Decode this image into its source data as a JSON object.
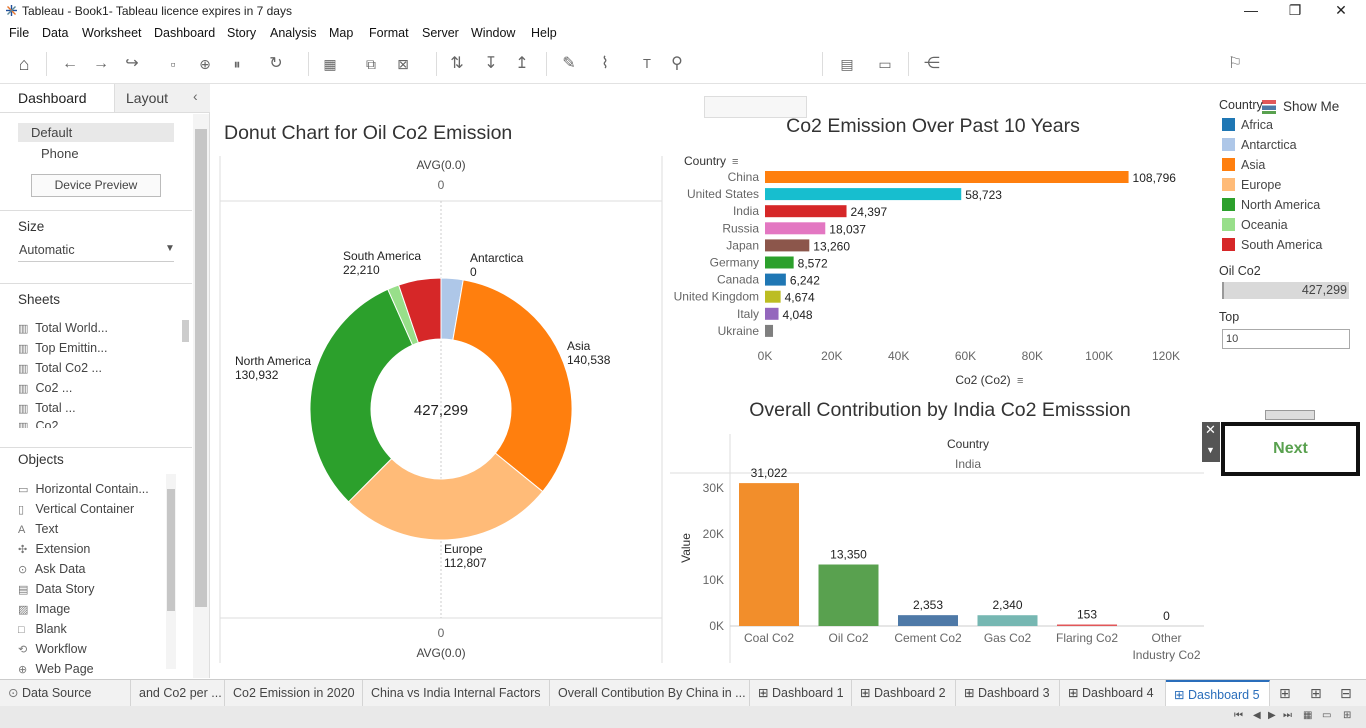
{
  "window": {
    "title": "Tableau - Book1- Tableau licence expires in 7 days",
    "minimize": "—",
    "restore": "❐",
    "close": "✕"
  },
  "menu": [
    "File",
    "Data",
    "Worksheet",
    "Dashboard",
    "Story",
    "Analysis",
    "Map",
    "Format",
    "Server",
    "Window",
    "Help"
  ],
  "toolbar": {
    "show_me": "Show Me"
  },
  "left_pane": {
    "tabs": [
      "Dashboard",
      "Layout"
    ],
    "device": {
      "default": "Default",
      "phone": "Phone",
      "preview_button": "Device Preview"
    },
    "size": {
      "heading": "Size",
      "value": "Automatic"
    },
    "sheets": {
      "heading": "Sheets",
      "items": [
        "Total World...",
        "Top Emittin...",
        "Total Co2 ...",
        "Co2 ...",
        "Total ...",
        "Co2"
      ]
    },
    "objects": {
      "heading": "Objects",
      "items": [
        "Horizontal Contain...",
        "Vertical Container",
        "Text",
        "Extension",
        "Ask Data",
        "Data Story",
        "Image",
        "Blank",
        "Workflow",
        "Web Page"
      ]
    }
  },
  "chart_data": [
    {
      "type": "pie",
      "title": "Donut Chart for Oil Co2 Emission",
      "top_label": "AVG(0.0)",
      "top_value": "0",
      "bottom_label": "AVG(0.0)",
      "bottom_value": "0",
      "center_label": "427,299",
      "categories": [
        "Africa",
        "Antarctica",
        "Asia",
        "Europe",
        "North America",
        "Oceania",
        "South America"
      ],
      "values": [
        0,
        11500,
        140538,
        112807,
        130932,
        6000,
        22210
      ],
      "labels": [
        {
          "name": "Antarctica",
          "value": "0"
        },
        {
          "name": "Asia",
          "value": "140,538"
        },
        {
          "name": "Europe",
          "value": "112,807"
        },
        {
          "name": "North America",
          "value": "130,932"
        },
        {
          "name": "South America",
          "value": "22,210"
        }
      ],
      "colors": [
        "#1f77b4",
        "#aec7e8",
        "#ff7f0e",
        "#ffbb78",
        "#2ca02c",
        "#98df8a",
        "#d62728"
      ]
    },
    {
      "type": "bar",
      "title": "Co2 Emission Over Past 10 Years",
      "orientation": "horizontal",
      "ylabel": "Country",
      "xlabel": "Co2 (Co2)",
      "categories": [
        "China",
        "United States",
        "India",
        "Russia",
        "Japan",
        "Germany",
        "Canada",
        "United Kingdom",
        "Italy",
        "Ukraine"
      ],
      "values": [
        108796,
        58723,
        24397,
        18037,
        13260,
        8572,
        6242,
        4674,
        4048,
        2400
      ],
      "value_labels": [
        "108,796",
        "58,723",
        "24,397",
        "18,037",
        "13,260",
        "8,572",
        "6,242",
        "4,674",
        "4,048",
        ""
      ],
      "colors": [
        "#ff7f0e",
        "#17becf",
        "#d62728",
        "#e377c2",
        "#8c564b",
        "#2ca02c",
        "#1f77b4",
        "#bcbd22",
        "#9467bd",
        "#7f7f7f"
      ],
      "xticks": [
        "0K",
        "20K",
        "40K",
        "60K",
        "80K",
        "100K",
        "120K"
      ],
      "xlim": [
        0,
        120000
      ]
    },
    {
      "type": "bar",
      "title": "Overall Contribution by India Co2 Emisssion",
      "header_label": "Country",
      "header_value": "India",
      "ylabel": "Value",
      "categories": [
        "Coal Co2",
        "Oil Co2",
        "Cement Co2",
        "Gas Co2",
        "Flaring Co2",
        "Other Industry Co2"
      ],
      "values": [
        31022,
        13350,
        2353,
        2340,
        153,
        0
      ],
      "value_labels": [
        "31,022",
        "13,350",
        "2,353",
        "2,340",
        "153",
        "0"
      ],
      "colors": [
        "#f28e2b",
        "#59a14f",
        "#4e79a7",
        "#76b7b2",
        "#e15759",
        "#bab0ac"
      ],
      "yticks": [
        "0K",
        "10K",
        "20K",
        "30K"
      ],
      "ylim": [
        0,
        33000
      ]
    }
  ],
  "legend": {
    "heading": "Country",
    "items": [
      {
        "label": "Africa",
        "color": "#1f77b4"
      },
      {
        "label": "Antarctica",
        "color": "#aec7e8"
      },
      {
        "label": "Asia",
        "color": "#ff7f0e"
      },
      {
        "label": "Europe",
        "color": "#ffbb78"
      },
      {
        "label": "North America",
        "color": "#2ca02c"
      },
      {
        "label": "Oceania",
        "color": "#98df8a"
      },
      {
        "label": "South America",
        "color": "#d62728"
      }
    ],
    "oil_heading": "Oil Co2",
    "oil_value": "427,299",
    "top_heading": "Top",
    "top_value": "10"
  },
  "next_button": "Next",
  "bottom_tabs": [
    "Data Source",
    "and Co2 per ...",
    "Co2 Emission in 2020",
    "China vs India Internal Factors",
    "Overall Contibution By China in ...",
    "Dashboard 1",
    "Dashboard 2",
    "Dashboard 3",
    "Dashboard 4",
    "Dashboard 5"
  ]
}
